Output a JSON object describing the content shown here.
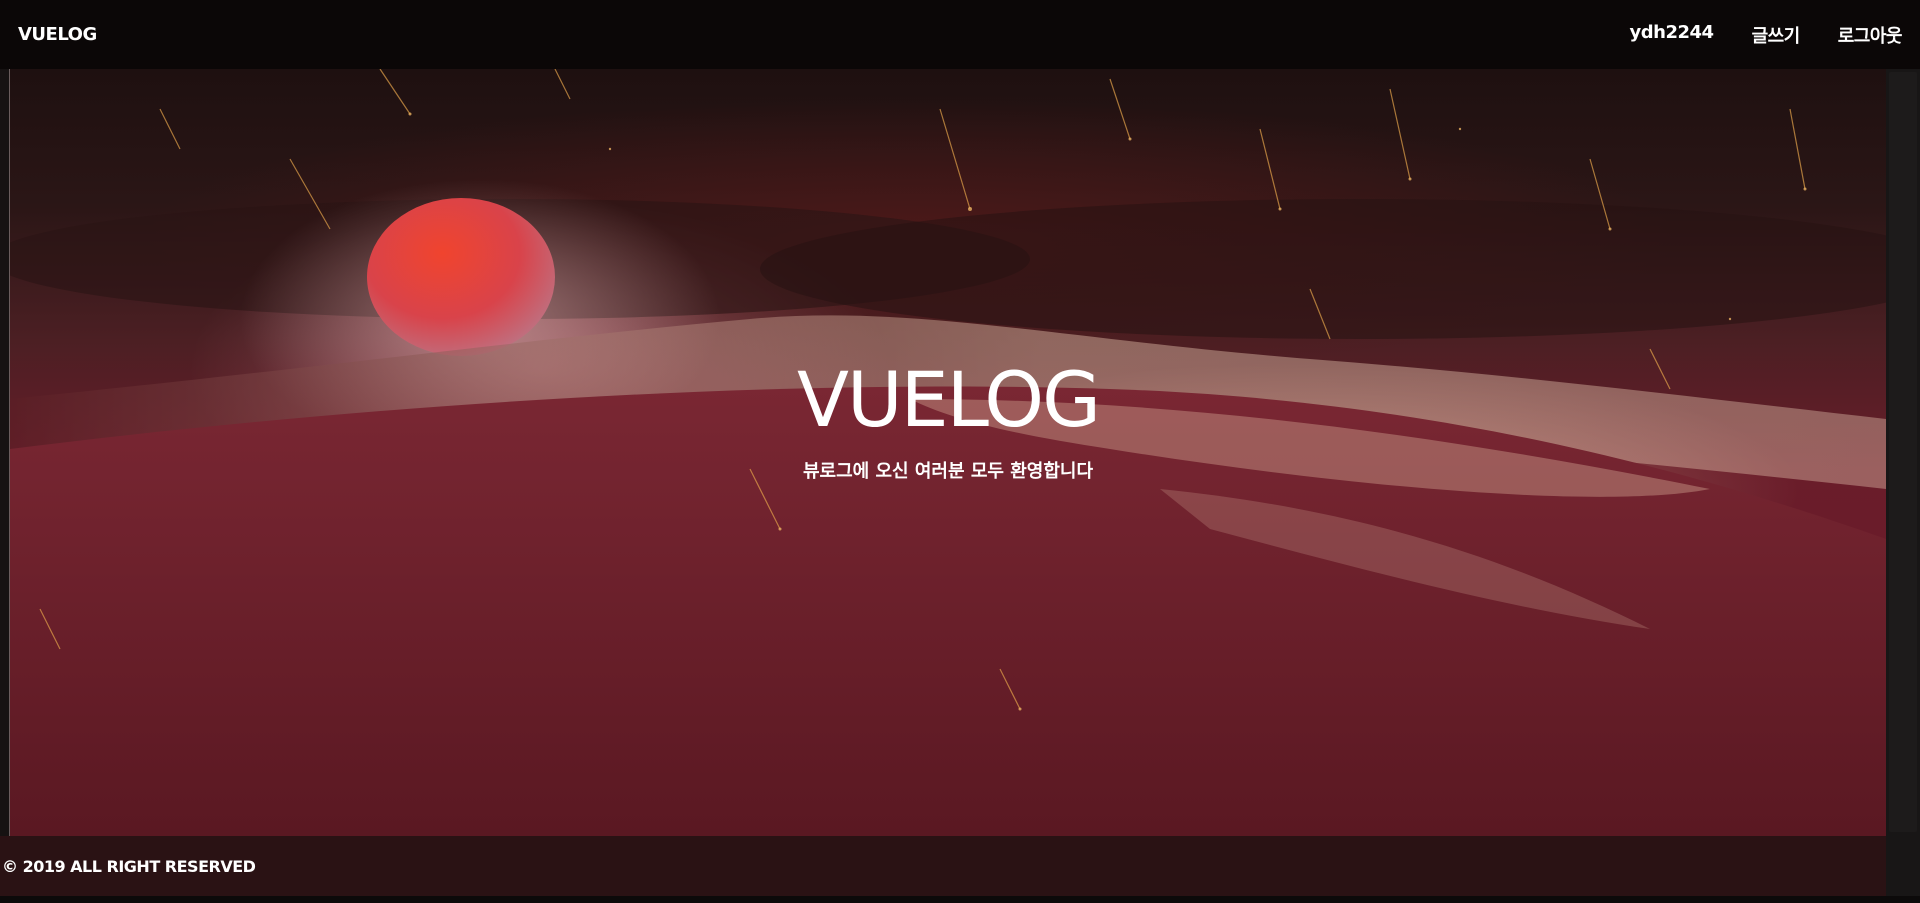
{
  "navbar": {
    "brand": "VUELOG",
    "links": [
      {
        "label": "ydh2244"
      },
      {
        "label": "글쓰기"
      },
      {
        "label": "로그아웃"
      }
    ]
  },
  "hero": {
    "title": "VUELOG",
    "subtitle": "뷰로그에 오신 여러분 모두 환영합니다"
  },
  "footer": {
    "text": "© 2019 ALL RIGHT RESERVED"
  },
  "colors": {
    "navbar_bg": "#0b0707",
    "hero_base": "#6b1b2a",
    "sun": "#e2453a",
    "footer_bg": "#2a1214",
    "text": "#ffffff"
  }
}
